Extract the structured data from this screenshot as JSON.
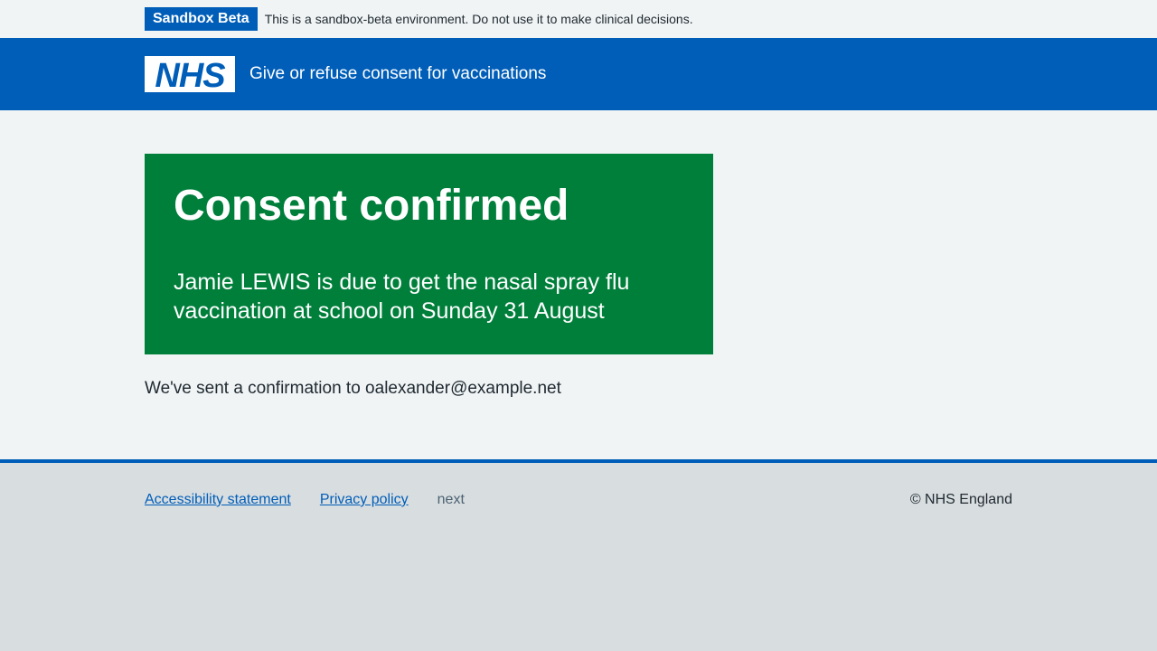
{
  "env_banner": {
    "tag": "Sandbox Beta",
    "text": "This is a sandbox-beta environment. Do not use it to make clinical decisions."
  },
  "header": {
    "logo_text": "NHS",
    "service_name": "Give or refuse consent for vaccinations"
  },
  "panel": {
    "title": "Consent confirmed",
    "body": "Jamie LEWIS is due to get the nasal spray flu vaccination at school on Sunday 31 August"
  },
  "confirmation_text": "We've sent a confirmation to oalexander@example.net",
  "footer": {
    "links": [
      {
        "label": "Accessibility statement"
      },
      {
        "label": "Privacy policy"
      }
    ],
    "version": "next",
    "copyright": "© NHS England"
  },
  "colors": {
    "nhs_blue": "#005eb8",
    "success_green": "#007f3b",
    "background": "#f0f4f5",
    "footer_bg": "#d8dde0",
    "text": "#212b32"
  }
}
